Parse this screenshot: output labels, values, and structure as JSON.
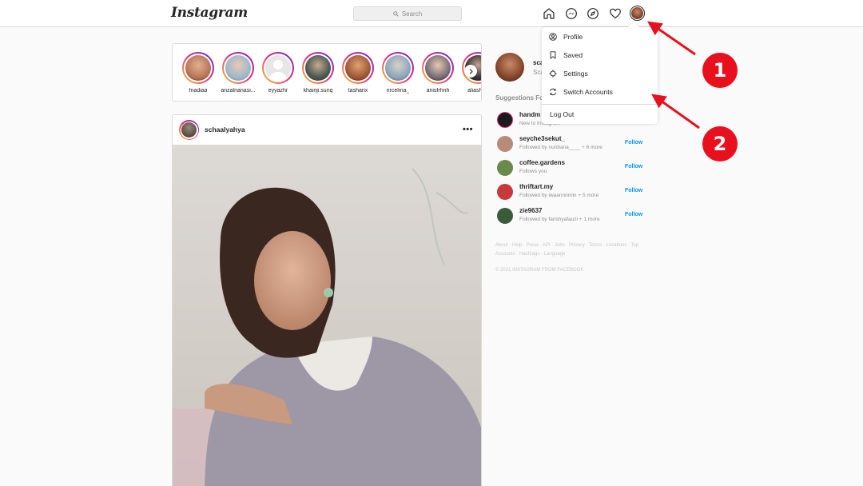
{
  "app": {
    "logo": "Instagram"
  },
  "search": {
    "placeholder": "Search"
  },
  "nav": {
    "icons": [
      "home-icon",
      "messenger-icon",
      "explore-icon",
      "heart-icon",
      "profile-avatar"
    ]
  },
  "stories": [
    {
      "name": "fnadiaa",
      "color": "#b9785a"
    },
    {
      "name": "anzalnanasi...",
      "color": "#9fb9c9"
    },
    {
      "name": "eyyazhr",
      "color": "#d9d9d9"
    },
    {
      "name": "khairiji.sunq",
      "color": "#4a5a52"
    },
    {
      "name": "tasharix",
      "color": "#a05a38"
    },
    {
      "name": "nrcelma_",
      "color": "#8ea7bd"
    },
    {
      "name": "anisfrhnh",
      "color": "#7a6e78"
    },
    {
      "name": "aliashaz",
      "color": "#3c3238"
    }
  ],
  "post": {
    "username": "schaalyahya",
    "more": "•••"
  },
  "me": {
    "username": "sca",
    "name": "Sca"
  },
  "suggestions": {
    "title": "Suggestions Fo",
    "items": [
      {
        "username": "handm",
        "sub": "New to Instagram",
        "follow": "",
        "color": "#1a1a1a"
      },
      {
        "username": "seyche3sekut_",
        "sub": "Followed by nurdiana____ + 6 more",
        "follow": "Follow",
        "color": "#b88a78"
      },
      {
        "username": "coffee.gardens",
        "sub": "Follows you",
        "follow": "Follow",
        "color": "#6b8a4a"
      },
      {
        "username": "thriftart.my",
        "sub": "Followed by iwaannnnnn + 5 more",
        "follow": "Follow",
        "color": "#c83a3a"
      },
      {
        "username": "zie9637",
        "sub": "Followed by farishyafauzi + 1 more",
        "follow": "Follow",
        "color": "#3a5a3a"
      }
    ]
  },
  "footer": {
    "links": "About · Help · Press · API · Jobs · Privacy · Terms · Locations · Top Accounts · Hashtags · Language",
    "copyright": "© 2021 INSTAGRAM FROM FACEBOOK"
  },
  "dropdown": {
    "profile": "Profile",
    "saved": "Saved",
    "settings": "Settings",
    "switch_accounts": "Switch Accounts",
    "log_out": "Log Out"
  },
  "annotations": {
    "badge1": "1",
    "badge2": "2",
    "color": "#e8101c"
  }
}
